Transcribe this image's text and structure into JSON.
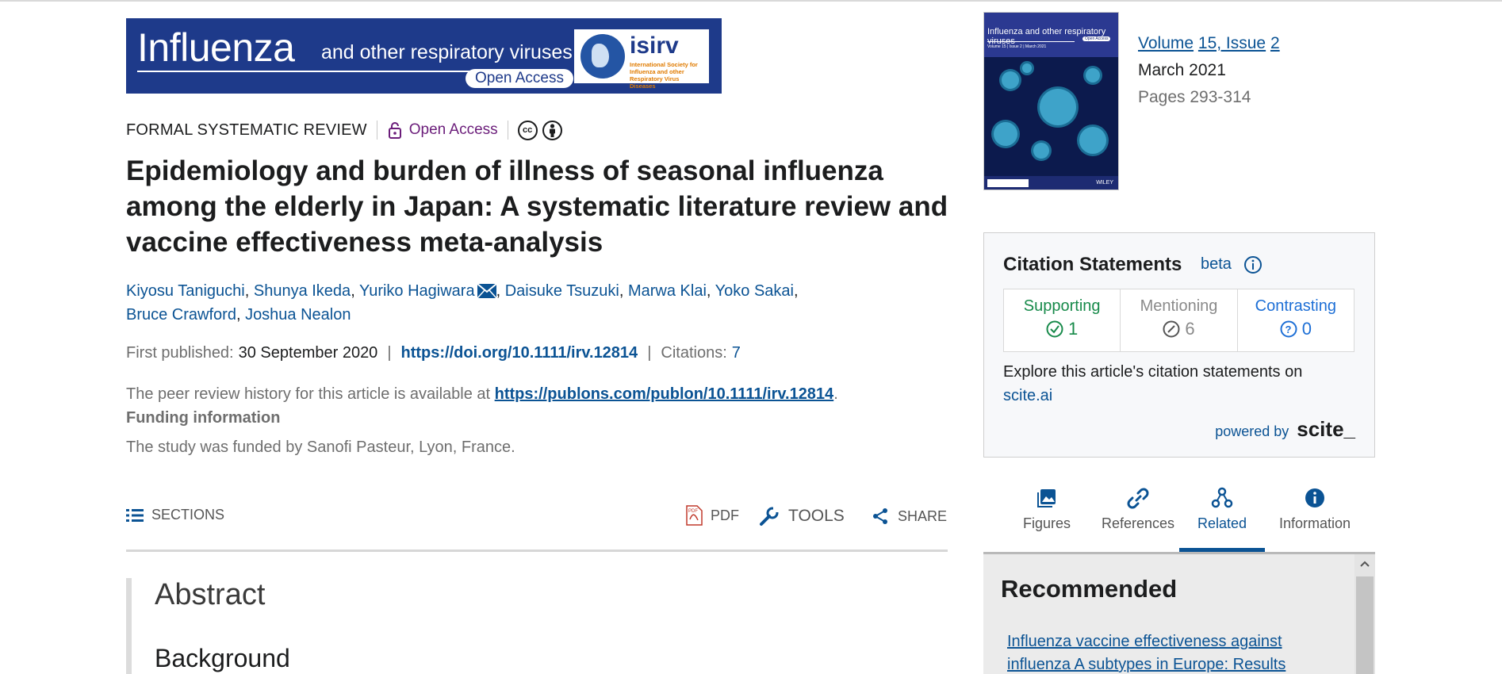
{
  "banner": {
    "title": "Influenza",
    "subtitle": "and other respiratory viruses",
    "open_access": "Open Access",
    "logo_text": "isirv",
    "logo_sub": "International Society for Influenza and other Respiratory Virus Diseases"
  },
  "article": {
    "type": "FORMAL SYSTEMATIC REVIEW",
    "open_access": "Open Access",
    "title": "Epidemiology and burden of illness of seasonal influenza among the elderly in Japan: A systematic literature review and vaccine effectiveness meta-analysis",
    "authors_line1": [
      {
        "name": "Kiyosu Taniguchi"
      },
      {
        "name": "Shunya Ikeda"
      },
      {
        "name": "Yuriko Hagiwara"
      },
      {
        "name": "Daisuke Tsuzuki"
      },
      {
        "name": "Marwa Klai"
      },
      {
        "name": "Yoko Sakai"
      }
    ],
    "authors_line2": [
      {
        "name": "Bruce Crawford"
      },
      {
        "name": "Joshua Nealon"
      }
    ],
    "first_published_label": "First published:",
    "first_published_value": "30 September 2020",
    "doi": "https://doi.org/10.1111/irv.12814",
    "citations_label": "Citations:",
    "citations_value": "7",
    "peer_review_text": "The peer review history for this article is available at ",
    "peer_review_link": "https://publons.com/publon/10.1111/irv.12814",
    "funding_heading": "Funding information",
    "funding_text": "The study was funded by Sanofi Pasteur, Lyon, France."
  },
  "toolbar": {
    "sections": "SECTIONS",
    "pdf": "PDF",
    "tools": "TOOLS",
    "share": "SHARE"
  },
  "abstract": {
    "heading": "Abstract",
    "background": "Background"
  },
  "cover": {
    "title": "Influenza and other respiratory viruses",
    "meta": "Volume 15 | Issue 2 | March 2021",
    "oa": "Open Access",
    "publisher": "WILEY"
  },
  "issue": {
    "volume": "Volume",
    "volume_issue": "15, Issue",
    "issue_no": "2",
    "date": "March 2021",
    "pages": "Pages 293-314"
  },
  "scite": {
    "heading": "Citation Statements",
    "beta": "beta",
    "supporting_label": "Supporting",
    "supporting_value": "1",
    "mentioning_label": "Mentioning",
    "mentioning_value": "6",
    "contrasting_label": "Contrasting",
    "contrasting_value": "0",
    "explore_text": "Explore this article's citation statements on ",
    "explore_link": "scite.ai",
    "powered_by": "powered by",
    "brand": "scite_"
  },
  "right_tabs": [
    {
      "label": "Figures",
      "icon": "image-icon"
    },
    {
      "label": "References",
      "icon": "link-icon"
    },
    {
      "label": "Related",
      "icon": "related-icon",
      "active": true
    },
    {
      "label": "Information",
      "icon": "info-icon"
    }
  ],
  "recommended": {
    "heading": "Recommended",
    "first_link": "Influenza vaccine effectiveness against influenza A subtypes in Europe: Results"
  },
  "colors": {
    "link": "#0b5394",
    "open_access": "#6b1d7a",
    "supporting": "#178a4a",
    "contrasting": "#1d6fd6",
    "banner": "#1e3a8a"
  }
}
